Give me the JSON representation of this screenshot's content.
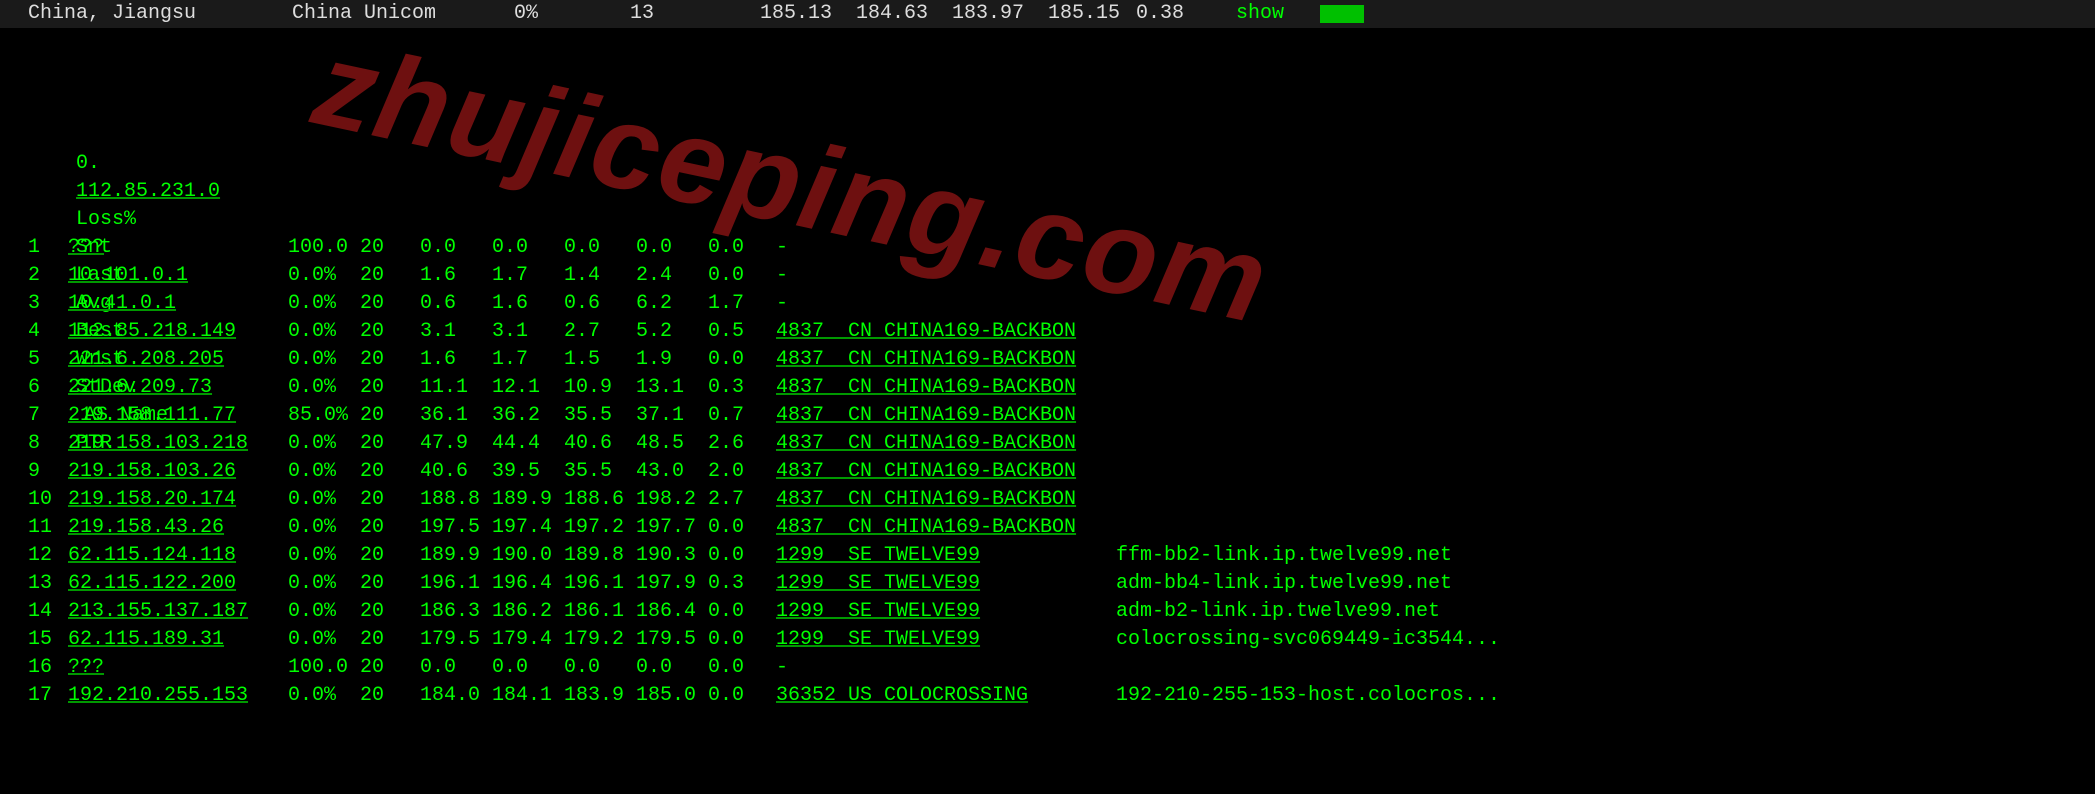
{
  "top": {
    "location": "China, Jiangsu",
    "isp": "China Unicom",
    "pct": "0%",
    "count": "13",
    "v1": "185.13",
    "v2": "184.63",
    "v3": "183.97",
    "v4": "185.15",
    "v5": "0.38",
    "show": "show"
  },
  "headers": {
    "idx": "0.",
    "host": "112.85.231.0",
    "loss": "Loss%",
    "snt": "Snt",
    "last": "Last",
    "avg": "Avg",
    "best": "Best",
    "wrst": "Wrst",
    "stdev": "StDev",
    "asname": "AS Name",
    "ptr": "PTR"
  },
  "rows": [
    {
      "n": "1",
      "host": "???",
      "loss": "100.0",
      "snt": "20",
      "last": "0.0",
      "avg": "0.0",
      "best": "0.0",
      "wrst": "0.0",
      "stdev": "0.0",
      "as": "-",
      "ptr": ""
    },
    {
      "n": "2",
      "host": "10.101.0.1",
      "loss": "0.0%",
      "snt": "20",
      "last": "1.6",
      "avg": "1.7",
      "best": "1.4",
      "wrst": "2.4",
      "stdev": "0.0",
      "as": "-",
      "ptr": ""
    },
    {
      "n": "3",
      "host": "10.41.0.1",
      "loss": "0.0%",
      "snt": "20",
      "last": "0.6",
      "avg": "1.6",
      "best": "0.6",
      "wrst": "6.2",
      "stdev": "1.7",
      "as": "-",
      "ptr": ""
    },
    {
      "n": "4",
      "host": "112.85.218.149",
      "loss": "0.0%",
      "snt": "20",
      "last": "3.1",
      "avg": "3.1",
      "best": "2.7",
      "wrst": "5.2",
      "stdev": "0.5",
      "as": "4837  CN CHINA169-BACKBON",
      "ptr": ""
    },
    {
      "n": "5",
      "host": "221.6.208.205",
      "loss": "0.0%",
      "snt": "20",
      "last": "1.6",
      "avg": "1.7",
      "best": "1.5",
      "wrst": "1.9",
      "stdev": "0.0",
      "as": "4837  CN CHINA169-BACKBON",
      "ptr": ""
    },
    {
      "n": "6",
      "host": "221.6.209.73",
      "loss": "0.0%",
      "snt": "20",
      "last": "11.1",
      "avg": "12.1",
      "best": "10.9",
      "wrst": "13.1",
      "stdev": "0.3",
      "as": "4837  CN CHINA169-BACKBON",
      "ptr": ""
    },
    {
      "n": "7",
      "host": "219.158.111.77",
      "loss": "85.0%",
      "snt": "20",
      "last": "36.1",
      "avg": "36.2",
      "best": "35.5",
      "wrst": "37.1",
      "stdev": "0.7",
      "as": "4837  CN CHINA169-BACKBON",
      "ptr": ""
    },
    {
      "n": "8",
      "host": "219.158.103.218",
      "loss": "0.0%",
      "snt": "20",
      "last": "47.9",
      "avg": "44.4",
      "best": "40.6",
      "wrst": "48.5",
      "stdev": "2.6",
      "as": "4837  CN CHINA169-BACKBON",
      "ptr": ""
    },
    {
      "n": "9",
      "host": "219.158.103.26",
      "loss": "0.0%",
      "snt": "20",
      "last": "40.6",
      "avg": "39.5",
      "best": "35.5",
      "wrst": "43.0",
      "stdev": "2.0",
      "as": "4837  CN CHINA169-BACKBON",
      "ptr": ""
    },
    {
      "n": "10",
      "host": "219.158.20.174",
      "loss": "0.0%",
      "snt": "20",
      "last": "188.8",
      "avg": "189.9",
      "best": "188.6",
      "wrst": "198.2",
      "stdev": "2.7",
      "as": "4837  CN CHINA169-BACKBON",
      "ptr": ""
    },
    {
      "n": "11",
      "host": "219.158.43.26",
      "loss": "0.0%",
      "snt": "20",
      "last": "197.5",
      "avg": "197.4",
      "best": "197.2",
      "wrst": "197.7",
      "stdev": "0.0",
      "as": "4837  CN CHINA169-BACKBON",
      "ptr": ""
    },
    {
      "n": "12",
      "host": "62.115.124.118",
      "loss": "0.0%",
      "snt": "20",
      "last": "189.9",
      "avg": "190.0",
      "best": "189.8",
      "wrst": "190.3",
      "stdev": "0.0",
      "as": "1299  SE TWELVE99",
      "ptr": "ffm-bb2-link.ip.twelve99.net"
    },
    {
      "n": "13",
      "host": "62.115.122.200",
      "loss": "0.0%",
      "snt": "20",
      "last": "196.1",
      "avg": "196.4",
      "best": "196.1",
      "wrst": "197.9",
      "stdev": "0.3",
      "as": "1299  SE TWELVE99",
      "ptr": "adm-bb4-link.ip.twelve99.net"
    },
    {
      "n": "14",
      "host": "213.155.137.187",
      "loss": "0.0%",
      "snt": "20",
      "last": "186.3",
      "avg": "186.2",
      "best": "186.1",
      "wrst": "186.4",
      "stdev": "0.0",
      "as": "1299  SE TWELVE99",
      "ptr": "adm-b2-link.ip.twelve99.net"
    },
    {
      "n": "15",
      "host": "62.115.189.31",
      "loss": "0.0%",
      "snt": "20",
      "last": "179.5",
      "avg": "179.4",
      "best": "179.2",
      "wrst": "179.5",
      "stdev": "0.0",
      "as": "1299  SE TWELVE99",
      "ptr": "colocrossing-svc069449-ic3544..."
    },
    {
      "n": "16",
      "host": "???",
      "loss": "100.0",
      "snt": "20",
      "last": "0.0",
      "avg": "0.0",
      "best": "0.0",
      "wrst": "0.0",
      "stdev": "0.0",
      "as": "-",
      "ptr": ""
    },
    {
      "n": "17",
      "host": "192.210.255.153",
      "loss": "0.0%",
      "snt": "20",
      "last": "184.0",
      "avg": "184.1",
      "best": "183.9",
      "wrst": "185.0",
      "stdev": "0.0",
      "as": "36352 US COLOCROSSING",
      "ptr": "192-210-255-153-host.colocros..."
    }
  ],
  "watermark": "zhujiceping.com"
}
